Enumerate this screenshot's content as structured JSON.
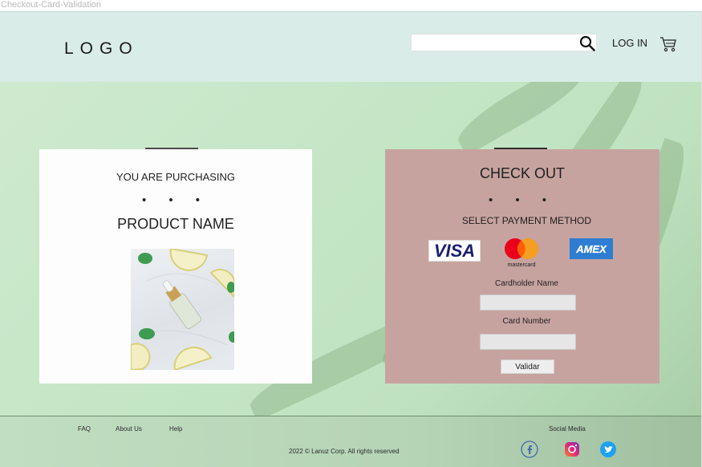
{
  "window": {
    "title": "Checkout-Card-Validation"
  },
  "header": {
    "logo": "LOGO",
    "search": {
      "value": "",
      "placeholder": ""
    },
    "login_label": "LOG IN",
    "icons": {
      "search": "search-icon",
      "cart": "cart-icon"
    }
  },
  "product_card": {
    "heading": "YOU ARE PURCHASING",
    "dots": "• • •",
    "product_name": "PRODUCT NAME",
    "image_icon": "serum-bottle-photo"
  },
  "checkout_card": {
    "title": "CHECK OUT",
    "dots": "• • •",
    "select_payment": "SELECT PAYMENT METHOD",
    "payment_methods": [
      {
        "name": "VISA",
        "color": "#1a1f71"
      },
      {
        "name": "mastercard",
        "color": "#eb001b"
      },
      {
        "name": "AMEX",
        "color": "#2d7dd2"
      }
    ],
    "cardholder_label": "Cardholder Name",
    "cardholder_value": "",
    "card_number_label": "Card Number",
    "card_number_value": "",
    "submit_label": "Validar"
  },
  "footer": {
    "links": [
      "FAQ",
      "About Us",
      "Help"
    ],
    "copyright": "2022 © Lanuz Corp. All rights reserved",
    "social_label": "Social Media",
    "social_icons": [
      "facebook-icon",
      "instagram-icon",
      "twitter-icon"
    ]
  },
  "colors": {
    "header_bg": "#d9ece7",
    "hero_bg": "#c3e6c5",
    "checkout_bg": "#c7a39f",
    "footer_bg": "#b5d3b5"
  }
}
